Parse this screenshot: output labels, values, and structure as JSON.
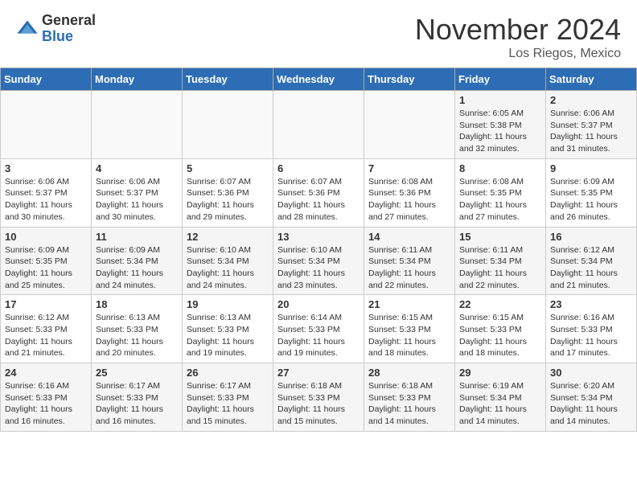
{
  "header": {
    "logo_general": "General",
    "logo_blue": "Blue",
    "month_title": "November 2024",
    "location": "Los Riegos, Mexico"
  },
  "weekdays": [
    "Sunday",
    "Monday",
    "Tuesday",
    "Wednesday",
    "Thursday",
    "Friday",
    "Saturday"
  ],
  "weeks": [
    [
      {
        "day": "",
        "text": ""
      },
      {
        "day": "",
        "text": ""
      },
      {
        "day": "",
        "text": ""
      },
      {
        "day": "",
        "text": ""
      },
      {
        "day": "",
        "text": ""
      },
      {
        "day": "1",
        "text": "Sunrise: 6:05 AM\nSunset: 5:38 PM\nDaylight: 11 hours and 32 minutes."
      },
      {
        "day": "2",
        "text": "Sunrise: 6:06 AM\nSunset: 5:37 PM\nDaylight: 11 hours and 31 minutes."
      }
    ],
    [
      {
        "day": "3",
        "text": "Sunrise: 6:06 AM\nSunset: 5:37 PM\nDaylight: 11 hours and 30 minutes."
      },
      {
        "day": "4",
        "text": "Sunrise: 6:06 AM\nSunset: 5:37 PM\nDaylight: 11 hours and 30 minutes."
      },
      {
        "day": "5",
        "text": "Sunrise: 6:07 AM\nSunset: 5:36 PM\nDaylight: 11 hours and 29 minutes."
      },
      {
        "day": "6",
        "text": "Sunrise: 6:07 AM\nSunset: 5:36 PM\nDaylight: 11 hours and 28 minutes."
      },
      {
        "day": "7",
        "text": "Sunrise: 6:08 AM\nSunset: 5:36 PM\nDaylight: 11 hours and 27 minutes."
      },
      {
        "day": "8",
        "text": "Sunrise: 6:08 AM\nSunset: 5:35 PM\nDaylight: 11 hours and 27 minutes."
      },
      {
        "day": "9",
        "text": "Sunrise: 6:09 AM\nSunset: 5:35 PM\nDaylight: 11 hours and 26 minutes."
      }
    ],
    [
      {
        "day": "10",
        "text": "Sunrise: 6:09 AM\nSunset: 5:35 PM\nDaylight: 11 hours and 25 minutes."
      },
      {
        "day": "11",
        "text": "Sunrise: 6:09 AM\nSunset: 5:34 PM\nDaylight: 11 hours and 24 minutes."
      },
      {
        "day": "12",
        "text": "Sunrise: 6:10 AM\nSunset: 5:34 PM\nDaylight: 11 hours and 24 minutes."
      },
      {
        "day": "13",
        "text": "Sunrise: 6:10 AM\nSunset: 5:34 PM\nDaylight: 11 hours and 23 minutes."
      },
      {
        "day": "14",
        "text": "Sunrise: 6:11 AM\nSunset: 5:34 PM\nDaylight: 11 hours and 22 minutes."
      },
      {
        "day": "15",
        "text": "Sunrise: 6:11 AM\nSunset: 5:34 PM\nDaylight: 11 hours and 22 minutes."
      },
      {
        "day": "16",
        "text": "Sunrise: 6:12 AM\nSunset: 5:34 PM\nDaylight: 11 hours and 21 minutes."
      }
    ],
    [
      {
        "day": "17",
        "text": "Sunrise: 6:12 AM\nSunset: 5:33 PM\nDaylight: 11 hours and 21 minutes."
      },
      {
        "day": "18",
        "text": "Sunrise: 6:13 AM\nSunset: 5:33 PM\nDaylight: 11 hours and 20 minutes."
      },
      {
        "day": "19",
        "text": "Sunrise: 6:13 AM\nSunset: 5:33 PM\nDaylight: 11 hours and 19 minutes."
      },
      {
        "day": "20",
        "text": "Sunrise: 6:14 AM\nSunset: 5:33 PM\nDaylight: 11 hours and 19 minutes."
      },
      {
        "day": "21",
        "text": "Sunrise: 6:15 AM\nSunset: 5:33 PM\nDaylight: 11 hours and 18 minutes."
      },
      {
        "day": "22",
        "text": "Sunrise: 6:15 AM\nSunset: 5:33 PM\nDaylight: 11 hours and 18 minutes."
      },
      {
        "day": "23",
        "text": "Sunrise: 6:16 AM\nSunset: 5:33 PM\nDaylight: 11 hours and 17 minutes."
      }
    ],
    [
      {
        "day": "24",
        "text": "Sunrise: 6:16 AM\nSunset: 5:33 PM\nDaylight: 11 hours and 16 minutes."
      },
      {
        "day": "25",
        "text": "Sunrise: 6:17 AM\nSunset: 5:33 PM\nDaylight: 11 hours and 16 minutes."
      },
      {
        "day": "26",
        "text": "Sunrise: 6:17 AM\nSunset: 5:33 PM\nDaylight: 11 hours and 15 minutes."
      },
      {
        "day": "27",
        "text": "Sunrise: 6:18 AM\nSunset: 5:33 PM\nDaylight: 11 hours and 15 minutes."
      },
      {
        "day": "28",
        "text": "Sunrise: 6:18 AM\nSunset: 5:33 PM\nDaylight: 11 hours and 14 minutes."
      },
      {
        "day": "29",
        "text": "Sunrise: 6:19 AM\nSunset: 5:34 PM\nDaylight: 11 hours and 14 minutes."
      },
      {
        "day": "30",
        "text": "Sunrise: 6:20 AM\nSunset: 5:34 PM\nDaylight: 11 hours and 14 minutes."
      }
    ]
  ]
}
